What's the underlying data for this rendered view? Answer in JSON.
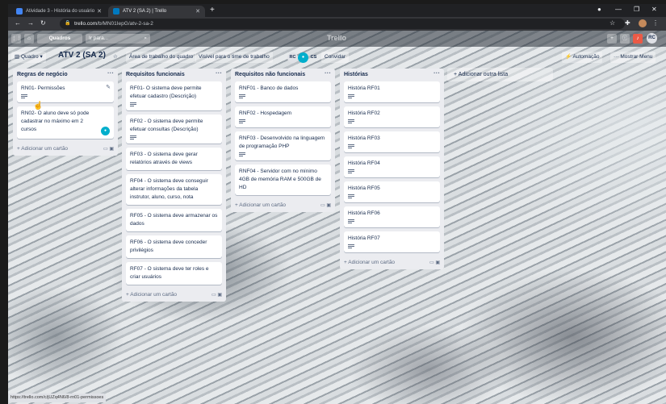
{
  "browser": {
    "tabs": [
      {
        "title": "Atividade 3 - História do usuário",
        "active": false
      },
      {
        "title": "ATV 2 (SA 2) | Trello",
        "active": true
      }
    ],
    "url_domain": "trello.com",
    "url_path": "/b/MN01IepG/atv-2-sa-2"
  },
  "trello_header": {
    "boards_label": "Quadros",
    "search_placeholder": "Ir para...",
    "logo": "Trello",
    "avatar": "RC"
  },
  "board": {
    "view_label": "Quadro",
    "title": "ATV 2 (SA 2)",
    "workspace_label": "Área de trabalho do quadro",
    "visibility_label": "Visível para o time de trabalho",
    "members": [
      "RC",
      "CS"
    ],
    "invite_label": "Convidar",
    "automation_label": "Automação",
    "menu_label": "Mostrar Menu",
    "add_list_label": "+ Adicionar outra lista"
  },
  "lists": [
    {
      "title": "Regras de negócio",
      "cards": [
        {
          "text": "RN01- Permissões"
        },
        {
          "text": "RN02- O aluno deve só pode cadastrar no máximo em 2 cursos"
        }
      ],
      "add_label": "+ Adicionar um cartão"
    },
    {
      "title": "Requisitos funcionais",
      "cards": [
        {
          "text": "RF01- O sistema deve permite efetuar cadastro (Descrição)"
        },
        {
          "text": "RF02 - O sistema deve permite efetuar consultas (Descrição)"
        },
        {
          "text": "RF03 - O sistema deve gerar relatórios através de views"
        },
        {
          "text": "RF04 - O sistema deve conseguir alterar informações da tabela instrutor, aluno, curso, nota"
        },
        {
          "text": "RF05 - O sistema deve armazenar os dados"
        },
        {
          "text": "RF06 - O sistema deve conceder privilégios"
        },
        {
          "text": "RF07 - O sistema deve ter roles e criar usuários"
        }
      ],
      "add_label": "+ Adicionar um cartão"
    },
    {
      "title": "Requisitos não funcionais",
      "cards": [
        {
          "text": "RNF01 - Banco de dados"
        },
        {
          "text": "RNF02 - Hospedagem"
        },
        {
          "text": "RNF03 - Desenvolvido na linguagem de programação PHP"
        },
        {
          "text": "RNF04 - Servidor com no mínimo 4GB de memória RAM e 500GB de HD"
        }
      ],
      "add_label": "+ Adicionar um cartão"
    },
    {
      "title": "Histórias",
      "cards": [
        {
          "text": "História RF01"
        },
        {
          "text": "História RF02"
        },
        {
          "text": "História RF03"
        },
        {
          "text": "História RF04"
        },
        {
          "text": "História RF05"
        },
        {
          "text": "História RF06"
        },
        {
          "text": "História RF07"
        }
      ],
      "add_label": "+ Adicionar um cartão"
    }
  ],
  "status_url": "https://trello.com/c/jUZq4N6/8-rn01-permissoes"
}
